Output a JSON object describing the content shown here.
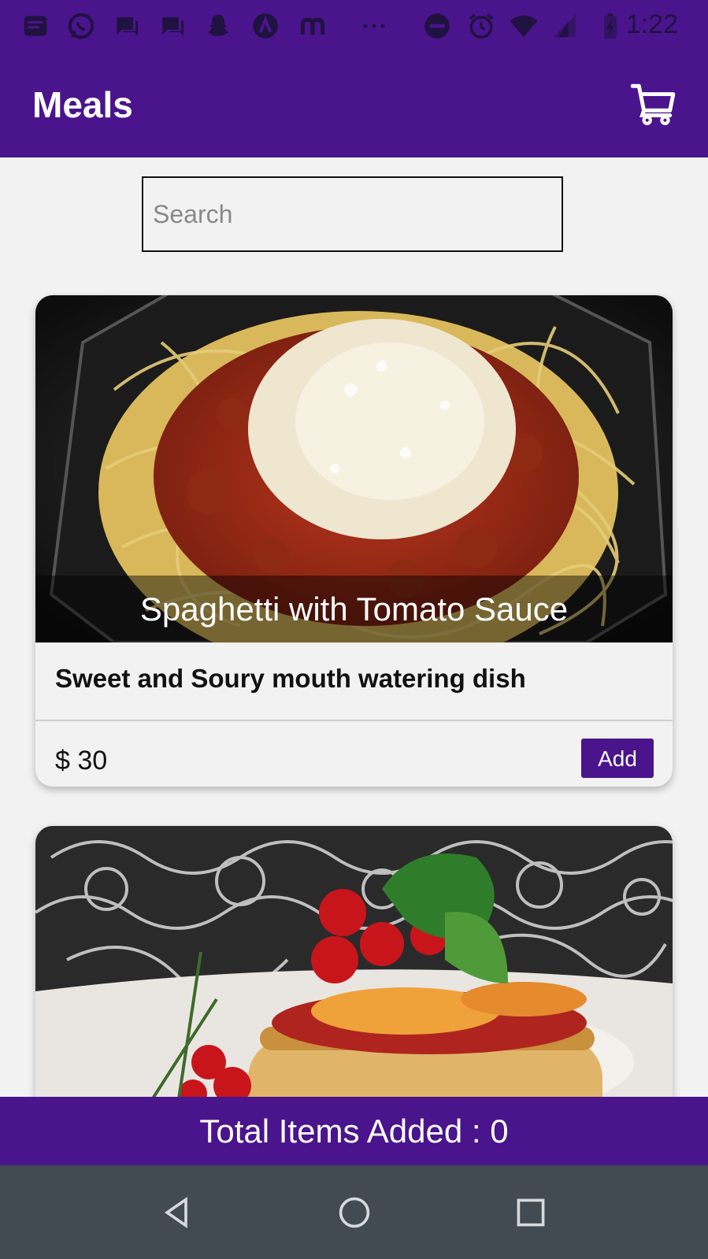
{
  "status_bar": {
    "time": "1:22",
    "icons": [
      "notification-icon",
      "whatsapp-icon",
      "message-icon",
      "message-icon",
      "snapchat-icon",
      "app-a-icon",
      "app-m-icon",
      "more-icon",
      "dnd-icon",
      "alarm-icon",
      "wifi-icon",
      "signal-icon",
      "battery-icon"
    ]
  },
  "app_bar": {
    "title": "Meals",
    "cart_icon": "cart-icon",
    "color": "#4a148c"
  },
  "search": {
    "placeholder": "Search",
    "value": ""
  },
  "meals": [
    {
      "title": "Spaghetti with Tomato Sauce",
      "description": "Sweet and Soury mouth watering dish",
      "price": "$ 30",
      "add_label": "Add"
    }
  ],
  "footer": {
    "total_label": "Total Items Added : 0"
  },
  "nav_bar": {
    "icons": [
      "back-icon",
      "home-icon",
      "recents-icon"
    ]
  }
}
